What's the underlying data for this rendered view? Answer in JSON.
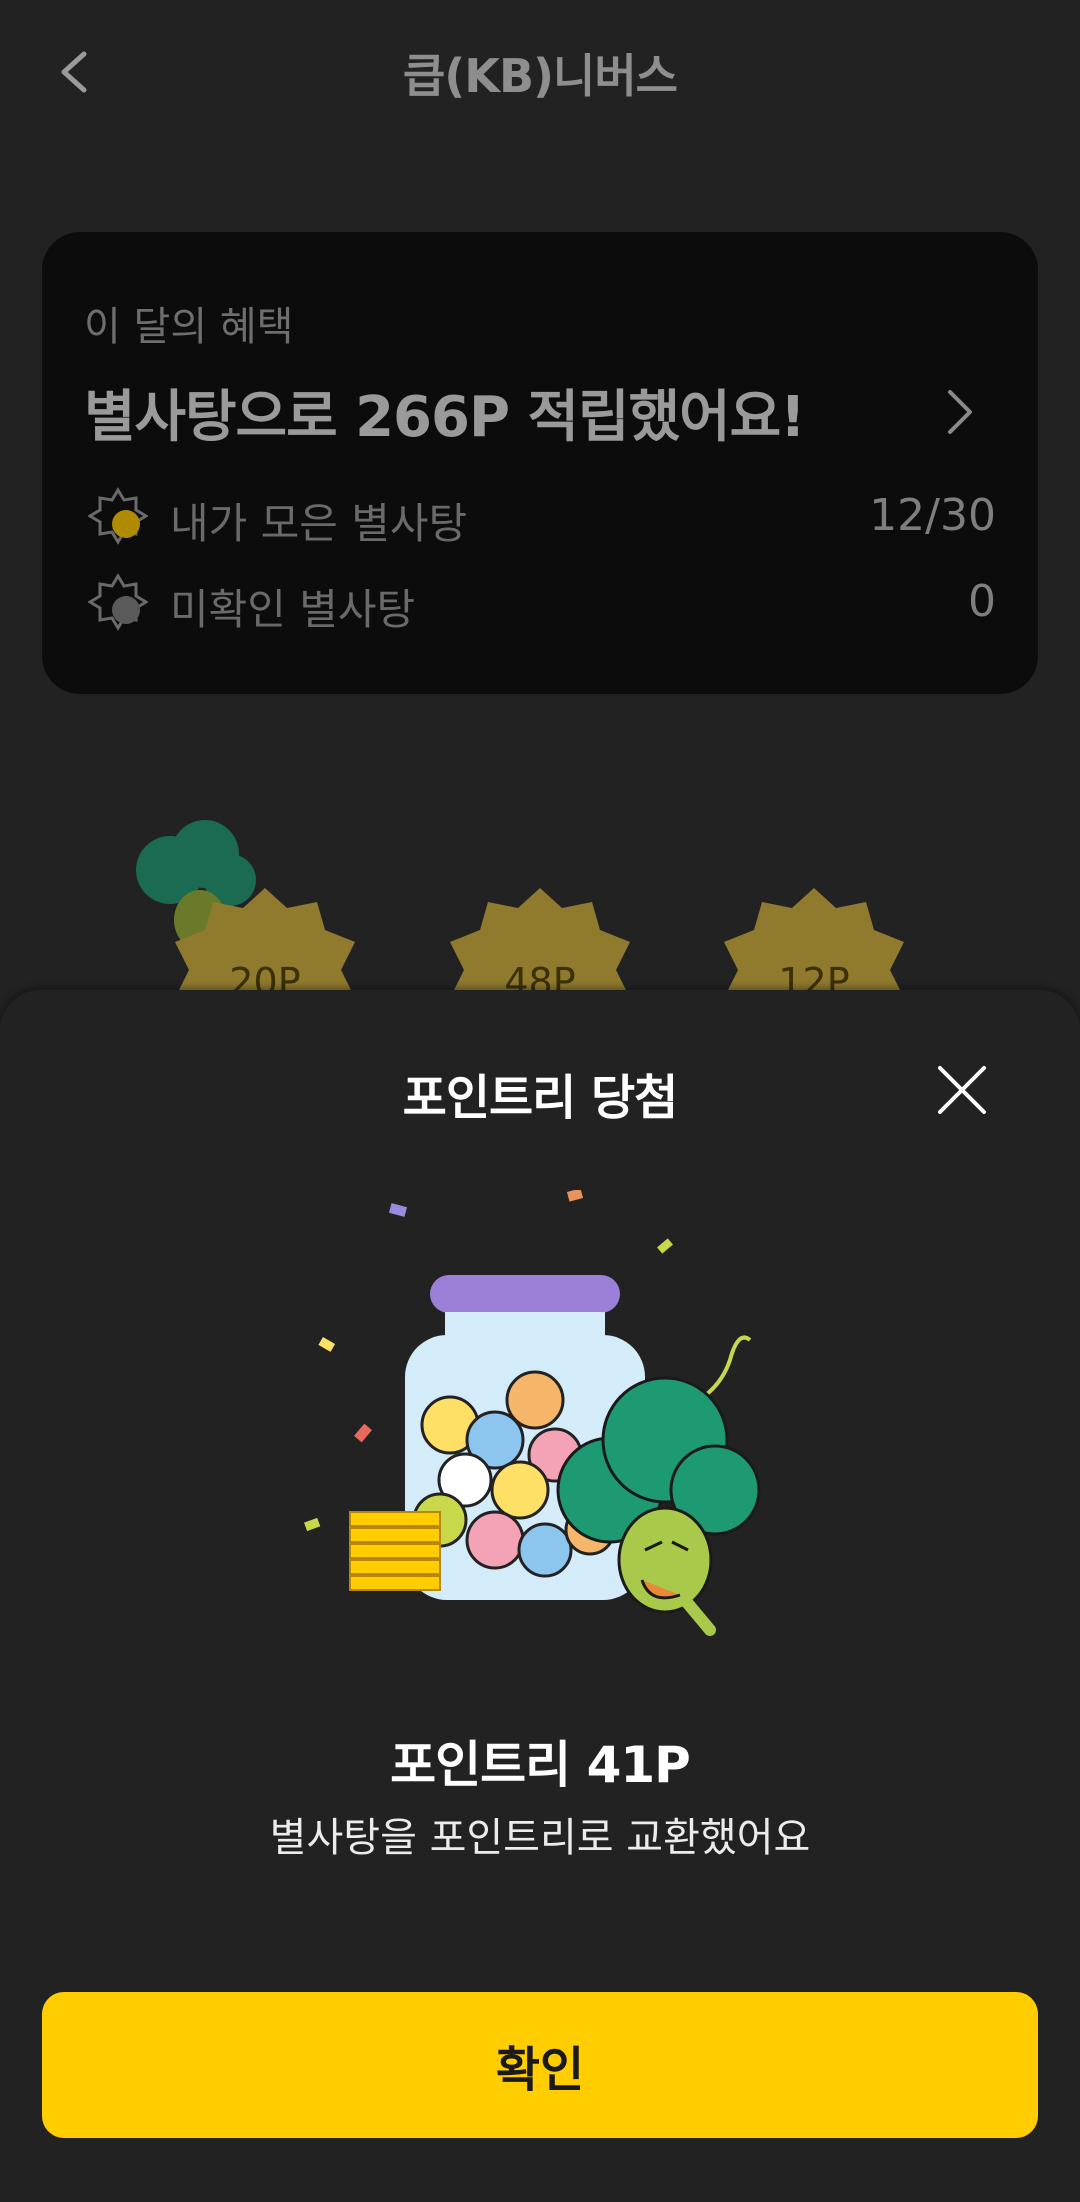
{
  "header": {
    "title": "큽(KB)니버스",
    "back_icon": "chevron-left-icon"
  },
  "benefit_card": {
    "caption": "이 달의 혜택",
    "headline": "별사탕으로 266P 적립했어요!",
    "collected": {
      "label": "내가 모은 별사탕",
      "value": "12/30",
      "icon": "star-candy-icon"
    },
    "unchecked": {
      "label": "미확인 별사탕",
      "value": "0",
      "icon": "star-candy-gray-icon"
    }
  },
  "rewards": [
    {
      "label": "20P"
    },
    {
      "label": "48P"
    },
    {
      "label": "12P"
    }
  ],
  "sheet": {
    "title": "포인트리 당첨",
    "reward_title": "포인트리 41P",
    "reward_desc": "별사탕을 포인트리로 교환했어요",
    "confirm_label": "확인"
  },
  "colors": {
    "accent": "#ffcd00",
    "background": "#222223",
    "card": "#0c0c0c"
  }
}
